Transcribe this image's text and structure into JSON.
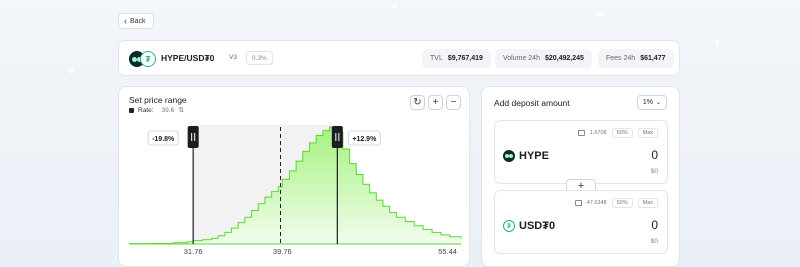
{
  "nav": {
    "back_label": "Back"
  },
  "pair": {
    "name": "HYPE/USD₮0",
    "version": "V3",
    "fee_tier": "0.3%",
    "stats": [
      {
        "label": "TVL",
        "value": "$9,767,419"
      },
      {
        "label": "Volume 24h",
        "value": "$20,492,245"
      },
      {
        "label": "Fees 24h",
        "value": "$61,477"
      }
    ]
  },
  "price_range": {
    "title": "Set price range",
    "rate_label": "Rate:",
    "rate_value": "39.6",
    "lower_pct": "-19.8%",
    "upper_pct": "+12.9%"
  },
  "deposit": {
    "title": "Add deposit amount",
    "slippage": "1%",
    "tokens": [
      {
        "symbol": "HYPE",
        "balance": "1.6708",
        "pct_btn": "50%",
        "max_btn": "Max",
        "amount": "0",
        "usd": "$0"
      },
      {
        "symbol": "USD₮0",
        "balance": "47.6348",
        "pct_btn": "50%",
        "max_btn": "Max",
        "amount": "0",
        "usd": "$0"
      }
    ]
  },
  "chart_data": {
    "type": "area",
    "x_ticks": [
      "31.76",
      "39.76",
      "55.44"
    ],
    "current_price": 39.6,
    "range_lower": 31.76,
    "range_upper": 44.7,
    "xlim": [
      26.0,
      55.8
    ],
    "x": [
      26.0,
      28.0,
      30.0,
      31.2,
      31.76,
      32.6,
      33.4,
      34.0,
      34.6,
      35.2,
      35.8,
      36.4,
      37.0,
      37.6,
      38.2,
      38.8,
      39.4,
      39.76,
      40.4,
      41.0,
      41.6,
      42.2,
      42.8,
      43.4,
      44.0,
      44.7,
      45.2,
      45.8,
      46.4,
      47.0,
      47.6,
      48.2,
      48.8,
      49.4,
      50.0,
      50.8,
      51.6,
      52.4,
      53.2,
      54.0,
      54.8,
      55.8
    ],
    "values": [
      0.3,
      0.5,
      1.0,
      1.8,
      2.8,
      3.5,
      4.6,
      6.8,
      9.5,
      13.0,
      17.5,
      22.0,
      27.5,
      33.0,
      38.5,
      43.0,
      47.0,
      53.0,
      60.0,
      68.0,
      76.0,
      83.0,
      89.0,
      93.0,
      96.0,
      92.0,
      78.0,
      66.0,
      57.0,
      49.0,
      42.0,
      36.0,
      31.0,
      26.0,
      22.0,
      18.5,
      15.0,
      12.0,
      9.5,
      7.5,
      6.0,
      4.5
    ]
  },
  "colors": {
    "accent": "#5ad82e",
    "fill_top": "#a6f27f",
    "fill_bottom": "#f1fded",
    "range_bg": "#f2f2f3"
  },
  "icons": [
    "chevron-left-icon",
    "hype-token-icon",
    "usdt0-token-icon",
    "refresh-icon",
    "zoom-in-icon",
    "zoom-out-icon",
    "swap-icon",
    "wallet-icon",
    "chevron-down-icon",
    "plus-icon"
  ]
}
